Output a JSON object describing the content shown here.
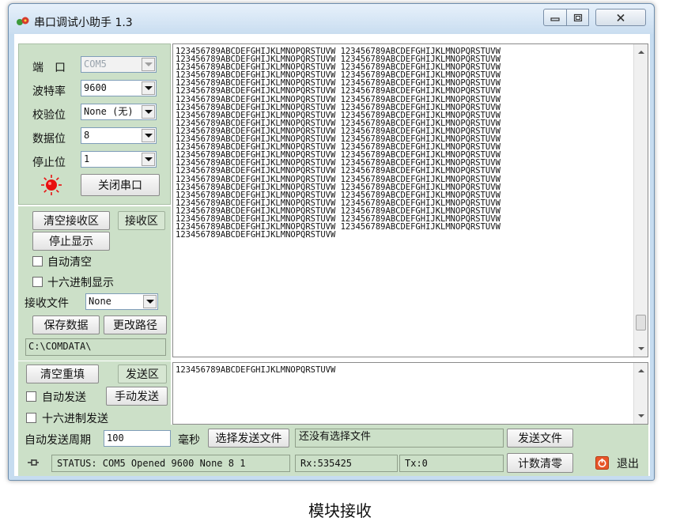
{
  "window": {
    "title": "串口调试小助手 1.3"
  },
  "settings": {
    "port_label": "端　口",
    "port_value": "COM5",
    "baud_label": "波特率",
    "baud_value": "9600",
    "parity_label": "校验位",
    "parity_value": "None (无)",
    "databits_label": "数据位",
    "databits_value": "8",
    "stopbits_label": "停止位",
    "stopbits_value": "1",
    "close_port_button": "关闭串口",
    "indicator_color": "#e81010"
  },
  "receive": {
    "clear_button": "清空接收区",
    "area_label": "接收区",
    "stop_display_button": "停止显示",
    "auto_clear_label": "自动清空",
    "hex_display_label": "十六进制显示",
    "file_label": "接收文件",
    "file_value": "None",
    "save_button": "保存数据",
    "change_path_button": "更改路径",
    "path_value": "C:\\COMDATA\\",
    "line_pair": "123456789ABCDEFGHIJKLMNOPQRSTUVW 123456789ABCDEFGHIJKLMNOPQRSTUVW",
    "last_line": "123456789ABCDEFGHIJKLMNOPQRSTUVW",
    "pair_count": 23
  },
  "send": {
    "clear_button": "清空重填",
    "area_label": "发送区",
    "auto_send_label": "自动发送",
    "manual_send_button": "手动发送",
    "hex_send_label": "十六进制发送",
    "period_label": "自动发送周期",
    "period_value": "100",
    "ms_label": "毫秒",
    "select_file_button": "选择发送文件",
    "file_status": "还没有选择文件",
    "send_file_button": "发送文件",
    "content": "123456789ABCDEFGHIJKLMNOPQRSTUVW"
  },
  "status": {
    "text": "STATUS: COM5 Opened 9600 None  8 1",
    "rx": "Rx:535425",
    "tx": "Tx:0",
    "reset_count_button": "计数清零",
    "exit_button": "退出"
  },
  "caption": "模块接收"
}
